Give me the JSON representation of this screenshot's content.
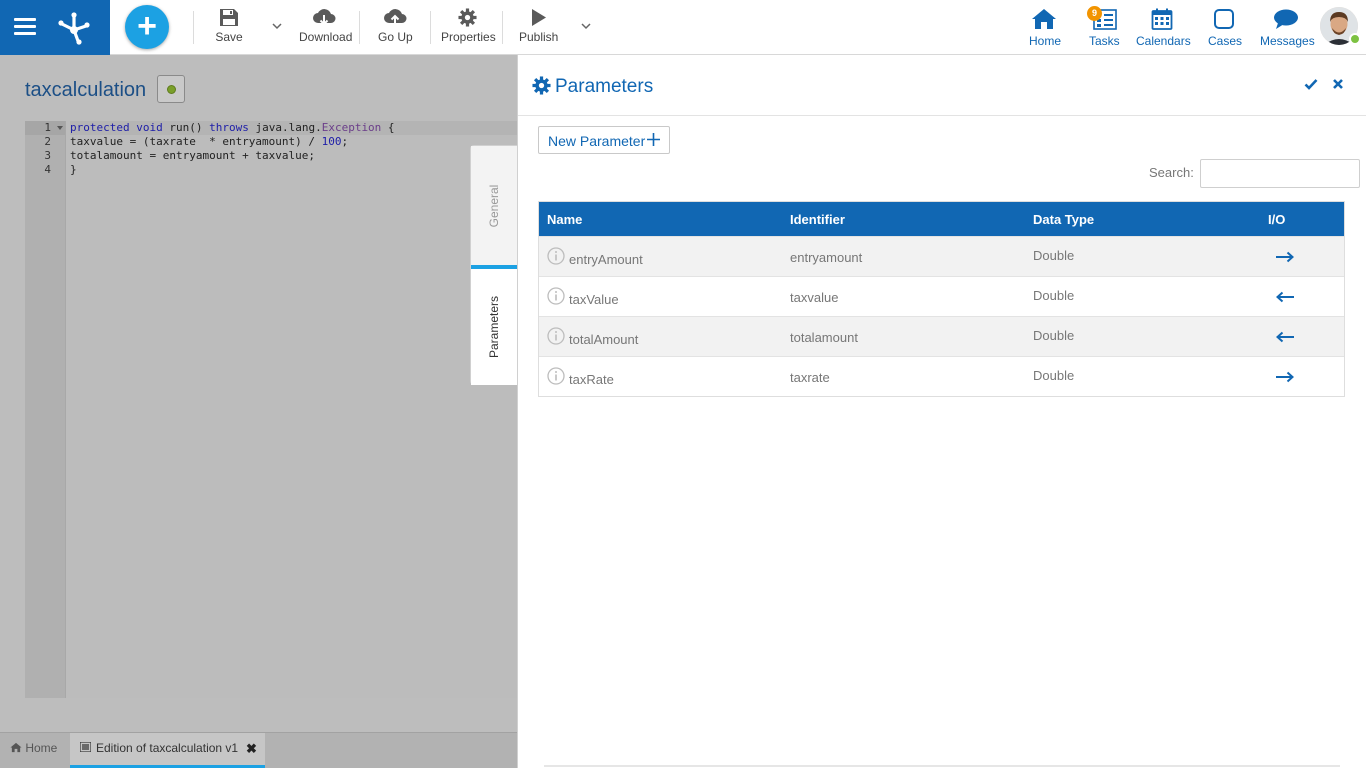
{
  "toolbar": {
    "save_label": "Save",
    "download_label": "Download",
    "goup_label": "Go Up",
    "properties_label": "Properties",
    "publish_label": "Publish"
  },
  "nav": {
    "home_label": "Home",
    "tasks_label": "Tasks",
    "tasks_badge": "9",
    "calendars_label": "Calendars",
    "cases_label": "Cases",
    "messages_label": "Messages"
  },
  "editor": {
    "title": "taxcalculation",
    "lines": [
      {
        "num": "1",
        "text": "protected void run() throws java.lang.Exception {"
      },
      {
        "num": "2",
        "text": "taxvalue = (taxrate  * entryamount) / 100;"
      },
      {
        "num": "3",
        "text": "totalamount = entryamount + taxvalue;"
      },
      {
        "num": "4",
        "text": "}"
      }
    ],
    "tab_general": "General",
    "tab_parameters": "Parameters"
  },
  "bottom_tabs": {
    "home": "Home",
    "edition": "Edition of taxcalculation v1"
  },
  "panel": {
    "title": "Parameters",
    "new_parameter": "New Parameter",
    "search_label": "Search:",
    "search_value": "",
    "columns": [
      "Name",
      "Identifier",
      "Data Type",
      "I/O"
    ],
    "rows": [
      {
        "name": "entryAmount",
        "identifier": "entryamount",
        "type": "Double",
        "io": "input"
      },
      {
        "name": "taxValue",
        "identifier": "taxvalue",
        "type": "Double",
        "io": "output"
      },
      {
        "name": "totalAmount",
        "identifier": "totalamount",
        "type": "Double",
        "io": "output"
      },
      {
        "name": "taxRate",
        "identifier": "taxrate",
        "type": "Double",
        "io": "input"
      }
    ]
  },
  "colors": {
    "brand": "#1167b3",
    "accent": "#1ca1e3",
    "badge": "#f29400",
    "online": "#7dc242"
  }
}
